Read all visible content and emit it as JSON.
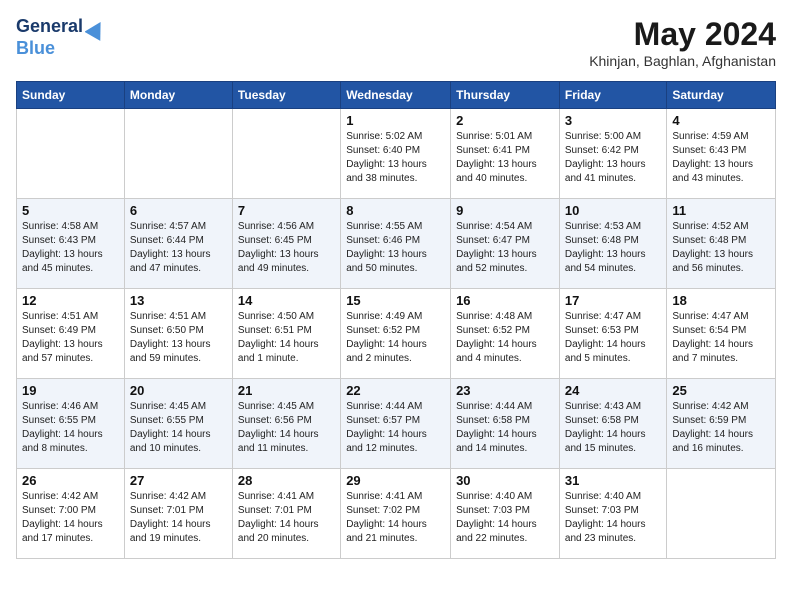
{
  "header": {
    "logo_line1": "General",
    "logo_line2": "Blue",
    "month_title": "May 2024",
    "location": "Khinjan, Baghlan, Afghanistan"
  },
  "days_of_week": [
    "Sunday",
    "Monday",
    "Tuesday",
    "Wednesday",
    "Thursday",
    "Friday",
    "Saturday"
  ],
  "weeks": [
    [
      {
        "day": "",
        "info": ""
      },
      {
        "day": "",
        "info": ""
      },
      {
        "day": "",
        "info": ""
      },
      {
        "day": "1",
        "info": "Sunrise: 5:02 AM\nSunset: 6:40 PM\nDaylight: 13 hours\nand 38 minutes."
      },
      {
        "day": "2",
        "info": "Sunrise: 5:01 AM\nSunset: 6:41 PM\nDaylight: 13 hours\nand 40 minutes."
      },
      {
        "day": "3",
        "info": "Sunrise: 5:00 AM\nSunset: 6:42 PM\nDaylight: 13 hours\nand 41 minutes."
      },
      {
        "day": "4",
        "info": "Sunrise: 4:59 AM\nSunset: 6:43 PM\nDaylight: 13 hours\nand 43 minutes."
      }
    ],
    [
      {
        "day": "5",
        "info": "Sunrise: 4:58 AM\nSunset: 6:43 PM\nDaylight: 13 hours\nand 45 minutes."
      },
      {
        "day": "6",
        "info": "Sunrise: 4:57 AM\nSunset: 6:44 PM\nDaylight: 13 hours\nand 47 minutes."
      },
      {
        "day": "7",
        "info": "Sunrise: 4:56 AM\nSunset: 6:45 PM\nDaylight: 13 hours\nand 49 minutes."
      },
      {
        "day": "8",
        "info": "Sunrise: 4:55 AM\nSunset: 6:46 PM\nDaylight: 13 hours\nand 50 minutes."
      },
      {
        "day": "9",
        "info": "Sunrise: 4:54 AM\nSunset: 6:47 PM\nDaylight: 13 hours\nand 52 minutes."
      },
      {
        "day": "10",
        "info": "Sunrise: 4:53 AM\nSunset: 6:48 PM\nDaylight: 13 hours\nand 54 minutes."
      },
      {
        "day": "11",
        "info": "Sunrise: 4:52 AM\nSunset: 6:48 PM\nDaylight: 13 hours\nand 56 minutes."
      }
    ],
    [
      {
        "day": "12",
        "info": "Sunrise: 4:51 AM\nSunset: 6:49 PM\nDaylight: 13 hours\nand 57 minutes."
      },
      {
        "day": "13",
        "info": "Sunrise: 4:51 AM\nSunset: 6:50 PM\nDaylight: 13 hours\nand 59 minutes."
      },
      {
        "day": "14",
        "info": "Sunrise: 4:50 AM\nSunset: 6:51 PM\nDaylight: 14 hours\nand 1 minute."
      },
      {
        "day": "15",
        "info": "Sunrise: 4:49 AM\nSunset: 6:52 PM\nDaylight: 14 hours\nand 2 minutes."
      },
      {
        "day": "16",
        "info": "Sunrise: 4:48 AM\nSunset: 6:52 PM\nDaylight: 14 hours\nand 4 minutes."
      },
      {
        "day": "17",
        "info": "Sunrise: 4:47 AM\nSunset: 6:53 PM\nDaylight: 14 hours\nand 5 minutes."
      },
      {
        "day": "18",
        "info": "Sunrise: 4:47 AM\nSunset: 6:54 PM\nDaylight: 14 hours\nand 7 minutes."
      }
    ],
    [
      {
        "day": "19",
        "info": "Sunrise: 4:46 AM\nSunset: 6:55 PM\nDaylight: 14 hours\nand 8 minutes."
      },
      {
        "day": "20",
        "info": "Sunrise: 4:45 AM\nSunset: 6:55 PM\nDaylight: 14 hours\nand 10 minutes."
      },
      {
        "day": "21",
        "info": "Sunrise: 4:45 AM\nSunset: 6:56 PM\nDaylight: 14 hours\nand 11 minutes."
      },
      {
        "day": "22",
        "info": "Sunrise: 4:44 AM\nSunset: 6:57 PM\nDaylight: 14 hours\nand 12 minutes."
      },
      {
        "day": "23",
        "info": "Sunrise: 4:44 AM\nSunset: 6:58 PM\nDaylight: 14 hours\nand 14 minutes."
      },
      {
        "day": "24",
        "info": "Sunrise: 4:43 AM\nSunset: 6:58 PM\nDaylight: 14 hours\nand 15 minutes."
      },
      {
        "day": "25",
        "info": "Sunrise: 4:42 AM\nSunset: 6:59 PM\nDaylight: 14 hours\nand 16 minutes."
      }
    ],
    [
      {
        "day": "26",
        "info": "Sunrise: 4:42 AM\nSunset: 7:00 PM\nDaylight: 14 hours\nand 17 minutes."
      },
      {
        "day": "27",
        "info": "Sunrise: 4:42 AM\nSunset: 7:01 PM\nDaylight: 14 hours\nand 19 minutes."
      },
      {
        "day": "28",
        "info": "Sunrise: 4:41 AM\nSunset: 7:01 PM\nDaylight: 14 hours\nand 20 minutes."
      },
      {
        "day": "29",
        "info": "Sunrise: 4:41 AM\nSunset: 7:02 PM\nDaylight: 14 hours\nand 21 minutes."
      },
      {
        "day": "30",
        "info": "Sunrise: 4:40 AM\nSunset: 7:03 PM\nDaylight: 14 hours\nand 22 minutes."
      },
      {
        "day": "31",
        "info": "Sunrise: 4:40 AM\nSunset: 7:03 PM\nDaylight: 14 hours\nand 23 minutes."
      },
      {
        "day": "",
        "info": ""
      }
    ]
  ]
}
